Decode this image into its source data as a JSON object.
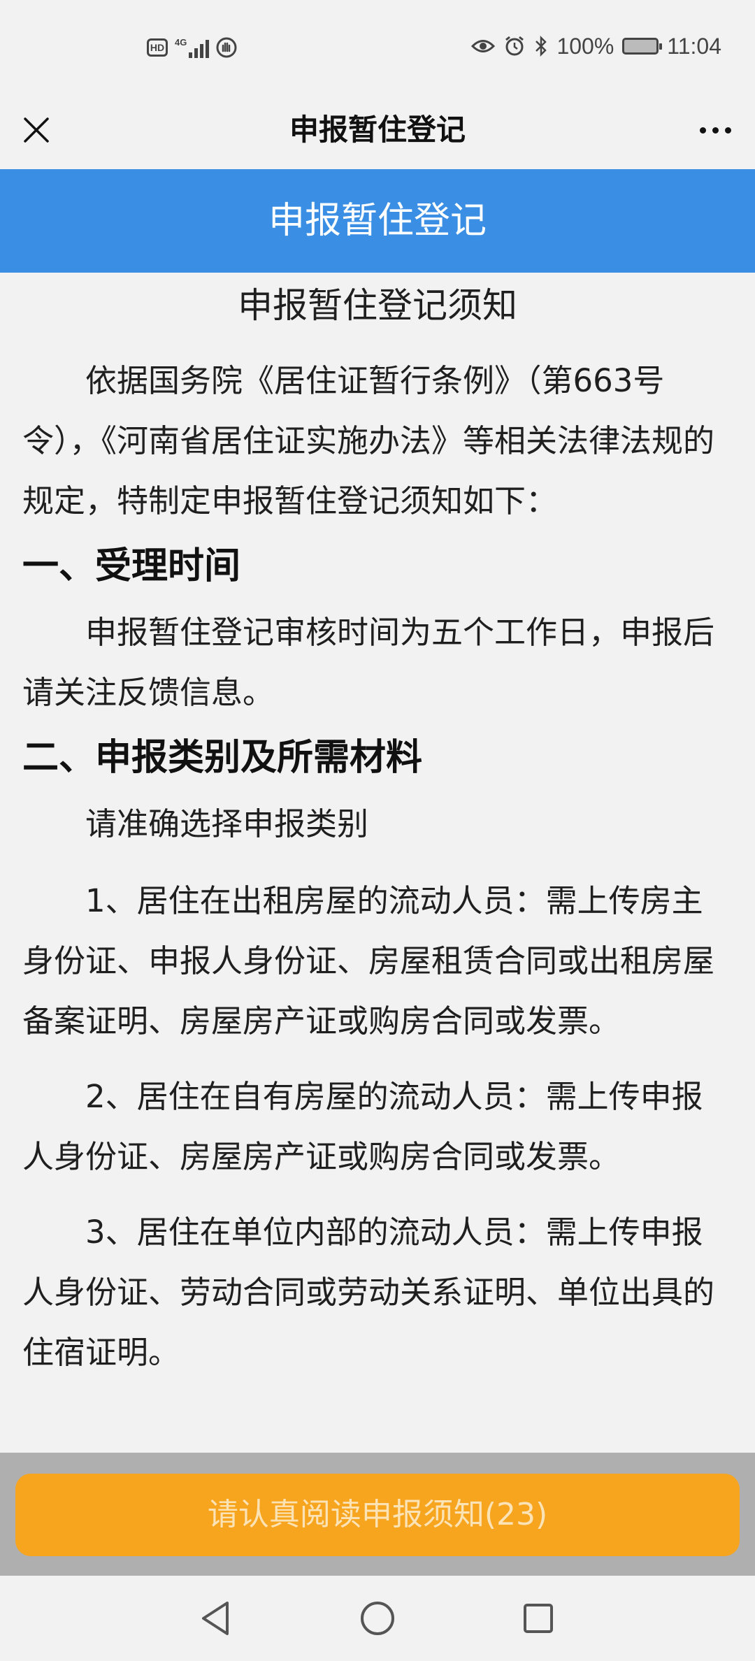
{
  "status_bar": {
    "hd_badge": "HD",
    "network_label": "4G",
    "battery_percent": "100%",
    "time": "11:04",
    "icons": [
      "hd-icon",
      "signal-icon",
      "hand-icon",
      "eye-icon",
      "alarm-icon",
      "bluetooth-icon",
      "battery-icon"
    ]
  },
  "title_bar": {
    "title": "申报暂住登记",
    "close_icon": "close-icon",
    "more_icon": "more-icon"
  },
  "header": {
    "title": "申报暂住登记",
    "color": "#3a8fe4"
  },
  "notice": {
    "title": "申报暂住登记须知",
    "intro": "依据国务院《居住证暂行条例》（第663号令），《河南省居住证实施办法》等相关法律法规的规定，特制定申报暂住登记须知如下：",
    "section1": {
      "heading": "一、受理时间",
      "text": "申报暂住登记审核时间为五个工作日，申报后请关注反馈信息。"
    },
    "section2": {
      "heading": "二、申报类别及所需材料",
      "prompt": "请准确选择申报类别",
      "items": [
        "1、居住在出租房屋的流动人员：需上传房主身份证、申报人身份证、房屋租赁合同或出租房屋备案证明、房屋房产证或购房合同或发票。",
        "2、居住在自有房屋的流动人员：需上传申报人身份证、房屋房产证或购房合同或发票。",
        "3、居住在单位内部的流动人员：需上传申报人身份证、劳动合同或劳动关系证明、单位出具的住宿证明。"
      ]
    }
  },
  "action": {
    "read_button_label": "请认真阅读申报须知(23)",
    "button_color": "#f7a41e"
  },
  "nav_bar": {
    "icons": [
      "back-icon",
      "home-icon",
      "recents-icon"
    ]
  }
}
